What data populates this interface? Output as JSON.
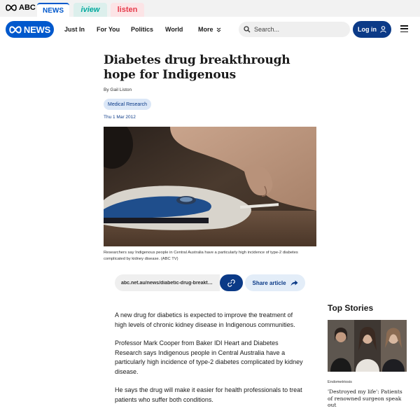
{
  "network_bar": {
    "abc_label": "ABC",
    "tabs": [
      {
        "label": "NEWS",
        "color": "#0058cc"
      },
      {
        "label": "iview",
        "color": "#00a99d"
      },
      {
        "label": "listen",
        "color": "#e63b4b"
      }
    ]
  },
  "header": {
    "logo_text": "NEWS",
    "nav": [
      "Just In",
      "For You",
      "Politics",
      "World"
    ],
    "more_label": "More",
    "search_placeholder": "Search...",
    "login_label": "Log in",
    "accent": "#0058cc",
    "dark_accent": "#0b3a87"
  },
  "article": {
    "headline": "Diabetes drug breakthrough hope for Indigenous",
    "byline_prefix": "By",
    "author": "Gail Liston",
    "topic": "Medical Research",
    "date": "Thu 1 Mar 2012",
    "image_caption": "Researchers say Indigenous people in Central Australia have a particularly high incidence of type-2 diabetes complicated by kidney disease. (ABC TV)",
    "share_url": "abc.net.au/news/diabetic-drug-breakthrough-hope-for-indigenous",
    "share_label": "Share article",
    "paragraphs": [
      "A new drug for diabetics is expected to improve the treatment of high levels of chronic kidney disease in Indigenous communities.",
      "Professor Mark Cooper from Baker IDI Heart and Diabetes Research says Indigenous people in Central Australia have a particularly high incidence of type-2 diabetes complicated by kidney disease.",
      "He says the drug will make it easier for health professionals to treat patients who suffer both conditions."
    ]
  },
  "sidebar": {
    "title": "Top Stories",
    "story": {
      "tag": "Endometriosis",
      "title": "'Destroyed my life': Patients of renowned surgeon speak out"
    }
  }
}
